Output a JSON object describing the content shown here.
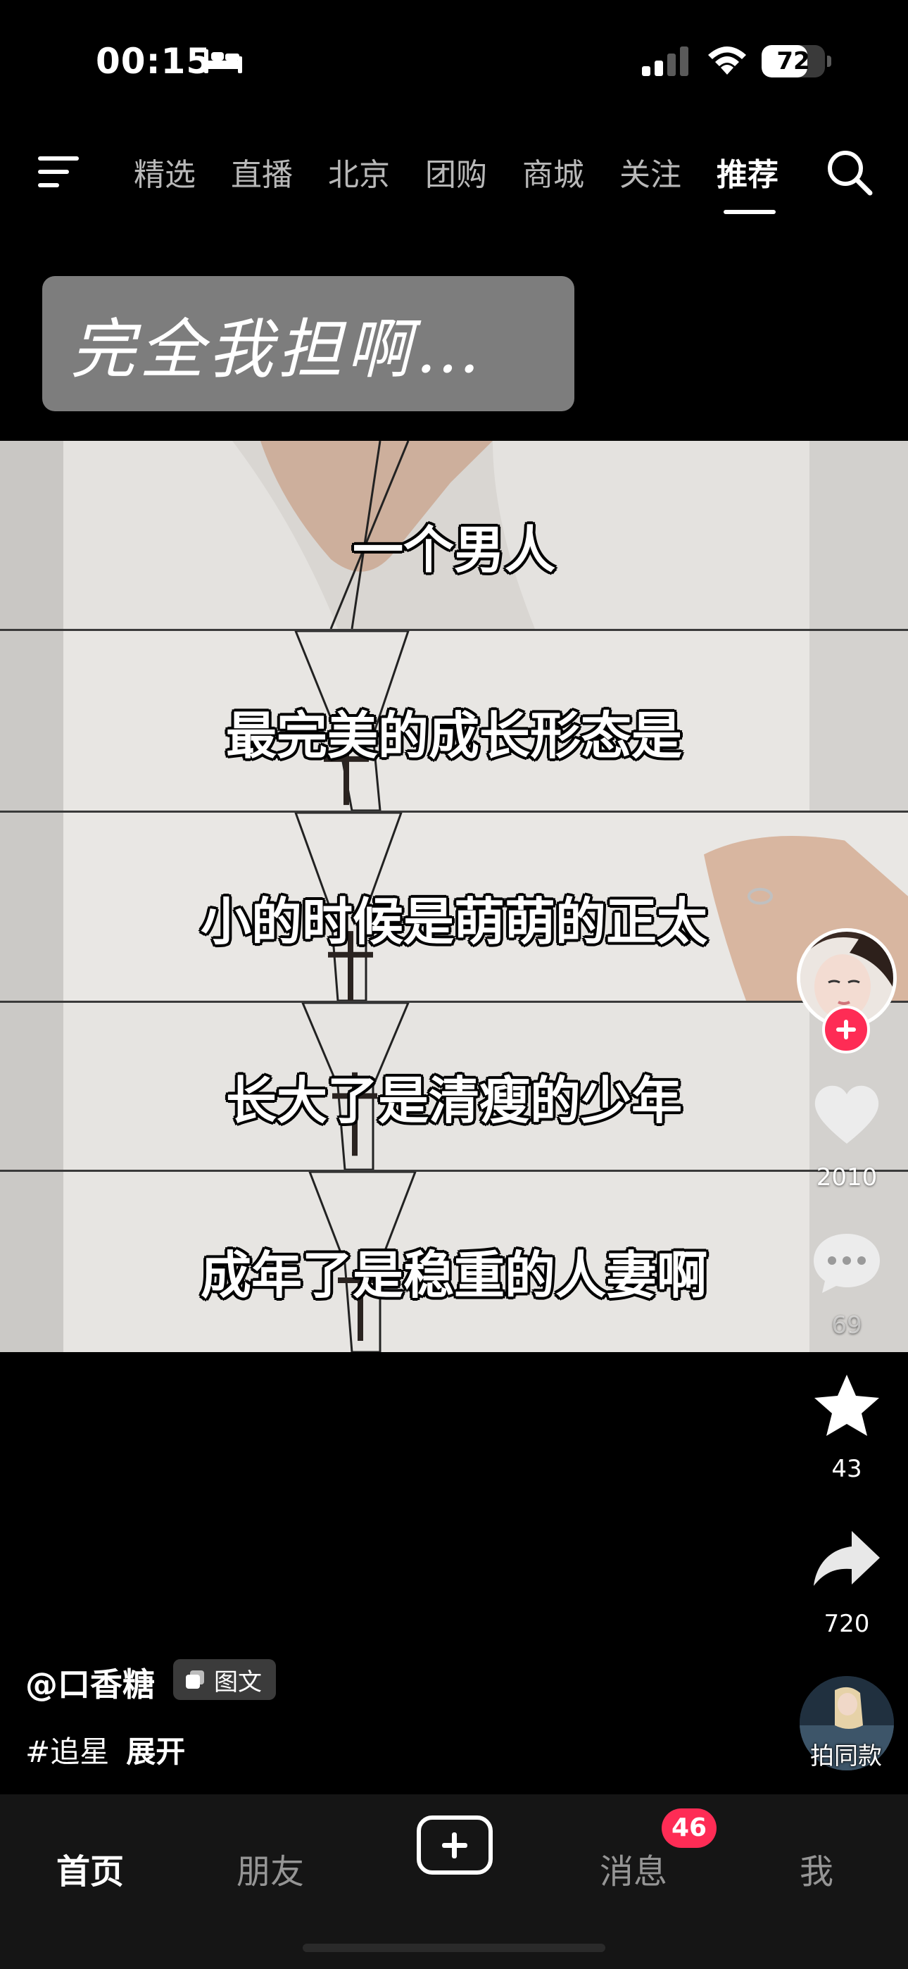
{
  "status_bar": {
    "time": "00:15",
    "battery_level": "72",
    "battery_fraction": 0.72
  },
  "top_nav": {
    "tabs": [
      "精选",
      "直播",
      "北京",
      "团购",
      "商城",
      "关注",
      "推荐"
    ],
    "active_tab": "推荐"
  },
  "post": {
    "title_card_text": "完全我担啊…",
    "captions": [
      "一个男人",
      "最完美的成长形态是",
      "小的时候是萌萌的正太",
      "长大了是清瘦的少年",
      "成年了是稳重的人妻啊"
    ],
    "author_handle": "@口香糖",
    "post_type_badge": "图文",
    "hashtag": "#追星",
    "expand_label": "展开"
  },
  "actions": {
    "likes": "2010",
    "comments": "69",
    "favorites": "43",
    "shares": "720",
    "music_label": "拍同款"
  },
  "tab_bar": {
    "home": "首页",
    "friends": "朋友",
    "messages": "消息",
    "messages_badge": "46",
    "me": "我"
  },
  "colors": {
    "accent": "#fe2c55",
    "background": "#000000",
    "tabbar_background": "#151515",
    "title_card": "#7d7d7d"
  },
  "icons": [
    "bed-icon",
    "signal-icon",
    "wifi-icon",
    "menu-icon",
    "search-icon",
    "plus-icon",
    "heart-icon",
    "comment-icon",
    "star-icon",
    "share-icon",
    "gallery-icon"
  ]
}
